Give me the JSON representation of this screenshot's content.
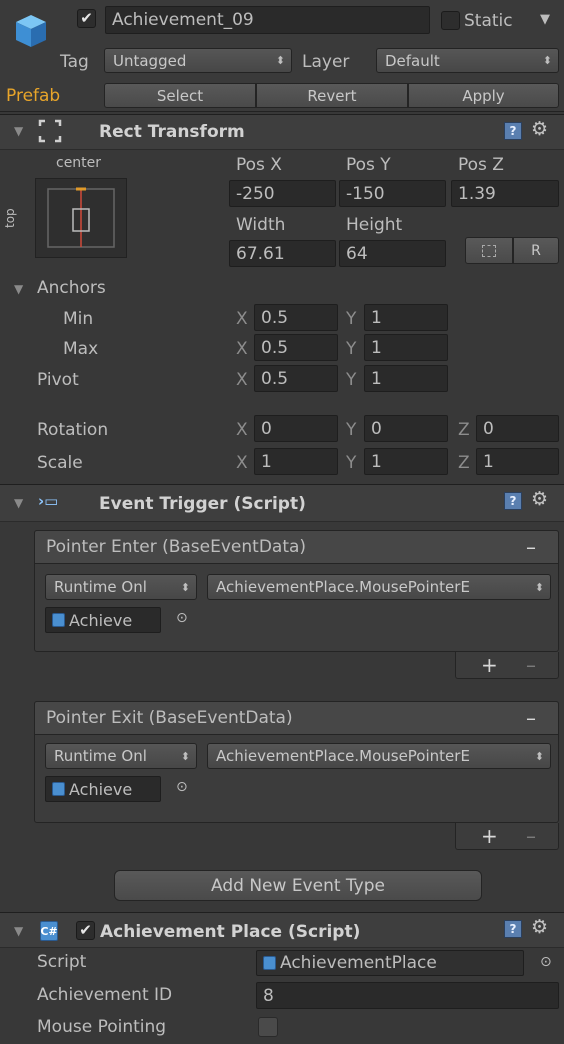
{
  "go": {
    "active": true,
    "name": "Achievement_09",
    "static_label": "Static",
    "tag_label": "Tag",
    "tag_value": "Untagged",
    "layer_label": "Layer",
    "layer_value": "Default",
    "prefab_label": "Prefab",
    "prefab_buttons": [
      "Select",
      "Revert",
      "Apply"
    ]
  },
  "rect": {
    "title": "Rect Transform",
    "anchor_h": "center",
    "anchor_v": "top",
    "pos_x_label": "Pos X",
    "pos_y_label": "Pos Y",
    "pos_z_label": "Pos Z",
    "pos_x": "-250",
    "pos_y": "-150",
    "pos_z": "1.39",
    "width_label": "Width",
    "height_label": "Height",
    "width": "67.61",
    "height": "64",
    "r_label": "R",
    "anchors_label": "Anchors",
    "min_label": "Min",
    "max_label": "Max",
    "pivot_label": "Pivot",
    "rotation_label": "Rotation",
    "scale_label": "Scale",
    "x": "X",
    "y": "Y",
    "z": "Z",
    "min_x": "0.5",
    "min_y": "1",
    "max_x": "0.5",
    "max_y": "1",
    "pivot_x": "0.5",
    "pivot_y": "1",
    "rot_x": "0",
    "rot_y": "0",
    "rot_z": "0",
    "scale_x": "1",
    "scale_y": "1",
    "scale_z": "1"
  },
  "trigger": {
    "title": "Event Trigger (Script)",
    "events": [
      {
        "title": "Pointer Enter (BaseEventData)",
        "runtime": "Runtime Onl",
        "function": "AchievementPlace.MousePointerE",
        "object": "Achieve"
      },
      {
        "title": "Pointer Exit (BaseEventData)",
        "runtime": "Runtime Onl",
        "function": "AchievementPlace.MousePointerE",
        "object": "Achieve"
      }
    ],
    "minus": "–",
    "plus": "+",
    "add_button": "Add New Event Type"
  },
  "place": {
    "title": "Achievement Place (Script)",
    "enabled": true,
    "script_label": "Script",
    "script_value": "AchievementPlace",
    "id_label": "Achievement ID",
    "id_value": "8",
    "mouse_label": "Mouse Pointing",
    "mouse_value": false
  },
  "icons": [
    "cube-icon",
    "recttransform-icon",
    "help-icon",
    "gear-icon",
    "script-icon",
    "target-icon",
    "blueprint-icon"
  ]
}
